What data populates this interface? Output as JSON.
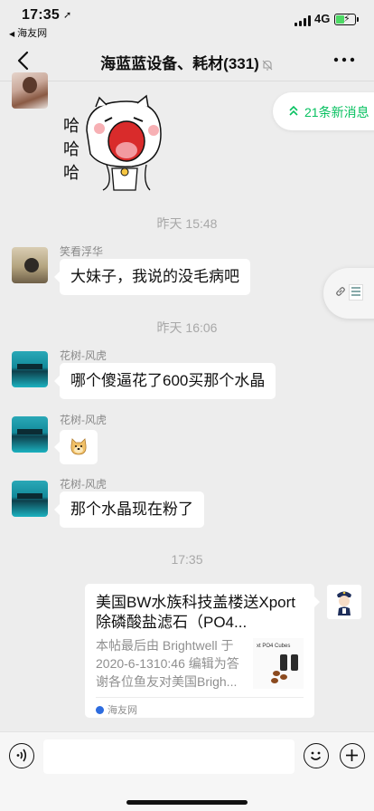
{
  "status_bar": {
    "time": "17:35",
    "back_app": "海友网",
    "network": "4G",
    "battery_color": "#4cd964"
  },
  "nav": {
    "title": "海蓝蓝设备、耗材(331)"
  },
  "new_messages": {
    "label": "21条新消息",
    "color": "#07c160"
  },
  "sticker": {
    "text_lines": [
      "哈",
      "哈",
      "哈"
    ]
  },
  "messages": [
    {
      "time": "昨天 15:48"
    },
    {
      "sender": "笑看浮华",
      "text": "大妹子，我说的没毛病吧"
    },
    {
      "time": "昨天 16:06"
    },
    {
      "sender": "花树-风虎",
      "text": "哪个傻逼花了600买那个水晶"
    },
    {
      "sender": "花树-风虎",
      "emoji": "doge"
    },
    {
      "sender": "花树-风虎",
      "text": "那个水晶现在粉了"
    },
    {
      "time": "17:35"
    }
  ],
  "link_card": {
    "title": "美国BW水族科技盖楼送Xport除磷酸盐滤石（PO4...",
    "description": "本帖最后由 Brightwell 于 2020-6-1310:46 编辑为答谢各位鱼友对美国Brigh...",
    "thumb_caption": "xt PO4 Cubes",
    "source": "海友网"
  }
}
